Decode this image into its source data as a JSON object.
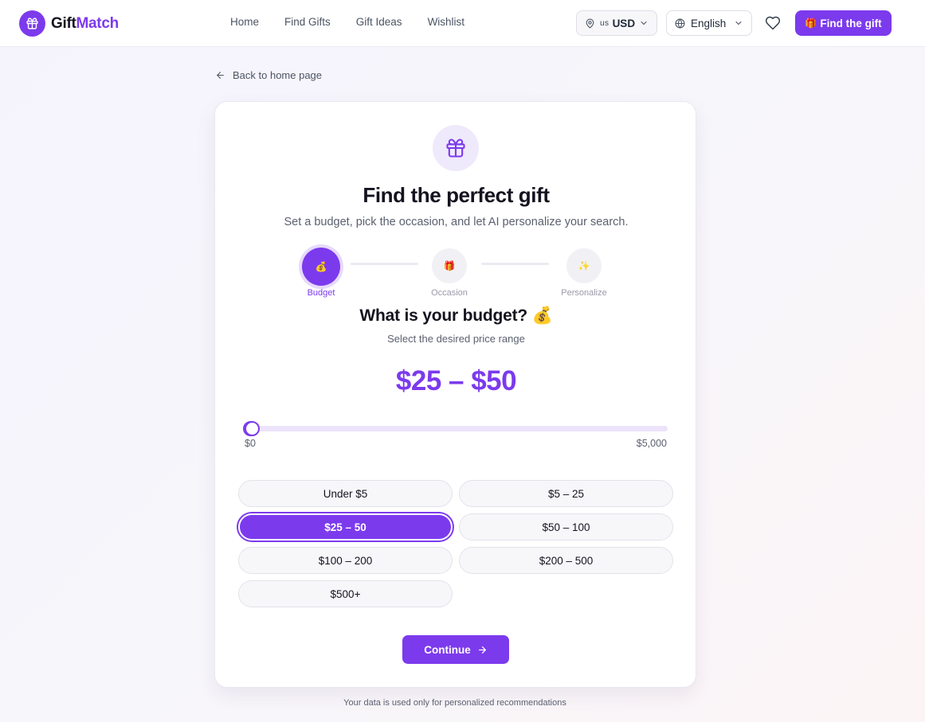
{
  "brand": {
    "name_part1": "Gift",
    "name_part2": "Match"
  },
  "nav": {
    "items": [
      {
        "label": "Home"
      },
      {
        "label": "Find Gifts"
      },
      {
        "label": "Gift Ideas"
      },
      {
        "label": "Wishlist"
      }
    ]
  },
  "header": {
    "currency": {
      "country": "us",
      "code": "USD"
    },
    "language": "English",
    "cta_label": "Find the gift",
    "cta_emoji": "🎁"
  },
  "back_link": "Back to home page",
  "card": {
    "title": "Find the perfect gift",
    "subtitle": "Set a budget, pick the occasion, and let AI personalize your search."
  },
  "steps": [
    {
      "label": "Budget",
      "emoji": "💰",
      "state": "active"
    },
    {
      "label": "Occasion",
      "emoji": "🎁",
      "state": "pending"
    },
    {
      "label": "Personalize",
      "emoji": "✨",
      "state": "pending"
    }
  ],
  "budget": {
    "question": "What is your budget? 💰",
    "hint": "Select the desired price range",
    "display": "$25 – $50",
    "slider": {
      "min_label": "$0",
      "max_label": "$5,000",
      "min": 0,
      "max": 5000,
      "low": 25,
      "high": 50
    },
    "options": [
      {
        "label": "Under $5",
        "selected": false
      },
      {
        "label": "$5 – 25",
        "selected": false
      },
      {
        "label": "$25 – 50",
        "selected": true
      },
      {
        "label": "$50 – 100",
        "selected": false
      },
      {
        "label": "$100 – 200",
        "selected": false
      },
      {
        "label": "$200 – 500",
        "selected": false
      },
      {
        "label": "$500+",
        "selected": false
      }
    ],
    "continue_label": "Continue"
  },
  "footer_note": "Your data is used only for personalized recommendations",
  "colors": {
    "accent": "#7c3aed",
    "accent_soft": "#efe9fc"
  }
}
